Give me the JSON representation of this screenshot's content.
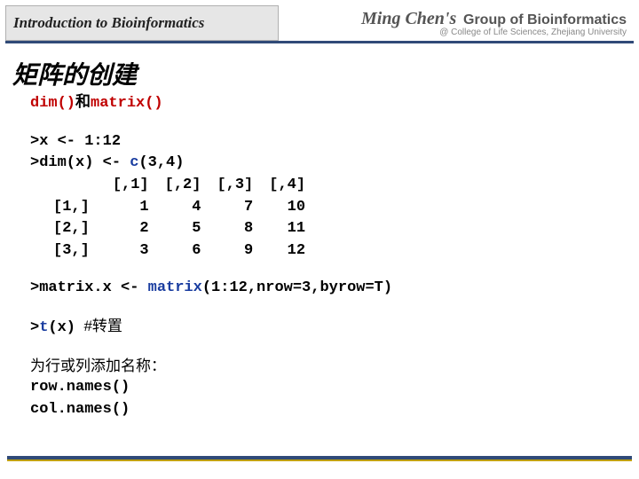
{
  "header": {
    "left": "Introduction to Bioinformatics",
    "right_cursive": "Ming Chen's",
    "right_group": "Group of Bioinformatics",
    "right_sub": "@ College of Life Sciences, Zhejiang University"
  },
  "title": "矩阵的创建",
  "line1": {
    "a": "dim()",
    "b": "和",
    "c": "matrix()"
  },
  "code": {
    "l1": ">x <- 1:12",
    "l2a": ">dim(x) <- ",
    "l2b": "c",
    "l2c": "(3,4)"
  },
  "matrix": {
    "cols": [
      "[,1]",
      "[,2]",
      "[,3]",
      "[,4]"
    ],
    "rows": [
      "[1,]",
      "[2,]",
      "[3,]"
    ],
    "vals": [
      [
        "1",
        "4",
        "7",
        "10"
      ],
      [
        "2",
        "5",
        "8",
        "11"
      ],
      [
        "3",
        "6",
        "9",
        "12"
      ]
    ]
  },
  "line3": {
    "a": ">matrix.x <- ",
    "b": "matrix",
    "c": "(1:12,nrow=3,byrow=T)"
  },
  "line4": {
    "a": ">",
    "b": "t",
    "c": "(x)",
    "d": "  #转置"
  },
  "line5": "为行或列添加名称：",
  "line6": "row.names()",
  "line7": "col.names()"
}
